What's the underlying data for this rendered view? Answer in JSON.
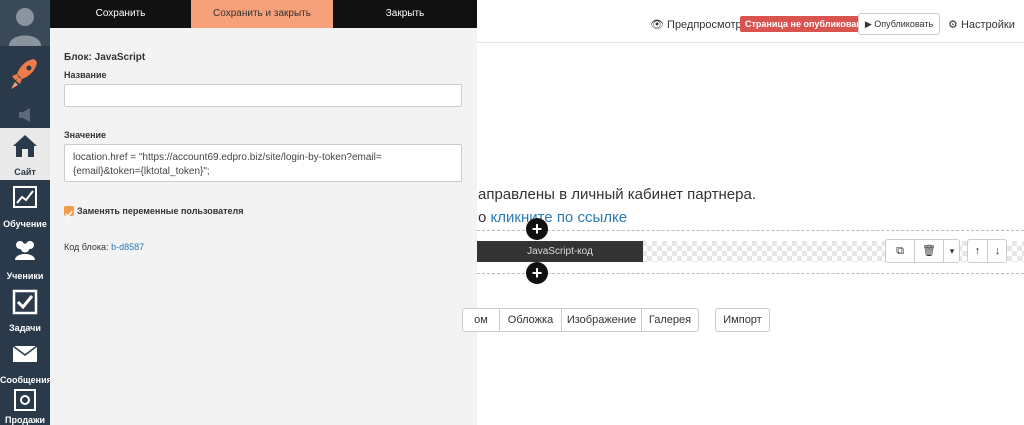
{
  "sidebar": {
    "items": [
      {
        "label": "Сайт"
      },
      {
        "label": "Обучение"
      },
      {
        "label": "Ученики"
      },
      {
        "label": "Задачи"
      },
      {
        "label": "Сообщения"
      },
      {
        "label": "Продажи"
      }
    ]
  },
  "editor": {
    "toolbar": {
      "save": "Сохранить",
      "save_close": "Сохранить и закрыть",
      "close": "Закрыть"
    },
    "title": "Блок: JavaScript",
    "name_label": "Название",
    "name_value": "",
    "value_label": "Значение",
    "value_line1": "location.href = \"https://account69.edpro.biz/site/login-by-token?email=",
    "value_line2": "{email}&token={lktotal_token}\";",
    "replace_vars_label": "Заменять переменные пользователя",
    "replace_vars_checked": true,
    "block_code_label": "Код блока:",
    "block_code_value": "b-d8587"
  },
  "header": {
    "preview": "Предпросмотр",
    "status_badge": "Страница не опубликована",
    "publish": "Опубликовать",
    "settings": "Настройки"
  },
  "content": {
    "text_line1": "аправлены в личный кабинет партнера.",
    "text_line2_prefix": "о ",
    "text_line2_link": "кликните по ссылке",
    "js_block_label": "JavaScript-код"
  },
  "block_types": [
    "ом",
    "Обложка",
    "Изображение",
    "Галерея"
  ],
  "import_label": "Импорт",
  "colors": {
    "sidebar_bg": "#2b3a4a",
    "accent_orange": "#f7a17a",
    "badge_red": "#d9534f",
    "link_blue": "#2a7ab5"
  }
}
